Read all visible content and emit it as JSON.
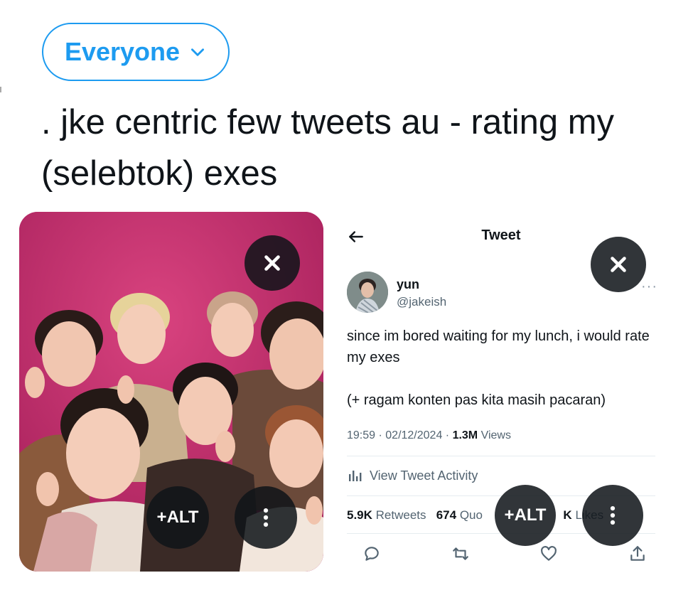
{
  "audience": {
    "label": "Everyone",
    "icon": "chevron-down-icon"
  },
  "compose": {
    "text": ". jke centric few tweets au - rating my (selebtok) exes"
  },
  "media": [
    {
      "kind": "photo",
      "buttons": {
        "remove_icon": "close-icon",
        "alt_label": "+ALT",
        "more_icon": "more-vertical-icon"
      }
    },
    {
      "kind": "tweet-screenshot",
      "buttons": {
        "remove_icon": "close-icon",
        "alt_label": "+ALT",
        "more_icon": "more-vertical-icon"
      },
      "screenshot": {
        "header_title": "Tweet",
        "author_name": "yun",
        "author_handle": "@jakeish",
        "more": "···",
        "body_line1": "since im bored waiting for my lunch, i would rate my exes",
        "body_line2": "(+ ragam konten pas kita masih pacaran)",
        "time": "19:59",
        "date": "02/12/2024",
        "views_count": "1.3M",
        "views_label": "Views",
        "activity_label": "View Tweet Activity",
        "retweets_count": "5.9K",
        "retweets_label": "Retweets",
        "quotes_count": "674",
        "quotes_label_visible": "Quo",
        "likes_count_visible": "K",
        "likes_label": "Likes",
        "action_icons": [
          "reply-icon",
          "retweet-icon",
          "like-icon",
          "share-icon"
        ]
      }
    }
  ],
  "colors": {
    "accent": "#1d9bf0",
    "text": "#0f1419",
    "secondary": "#536471",
    "overlay": "#0f1419",
    "photo_bg": "#c12b6b"
  }
}
